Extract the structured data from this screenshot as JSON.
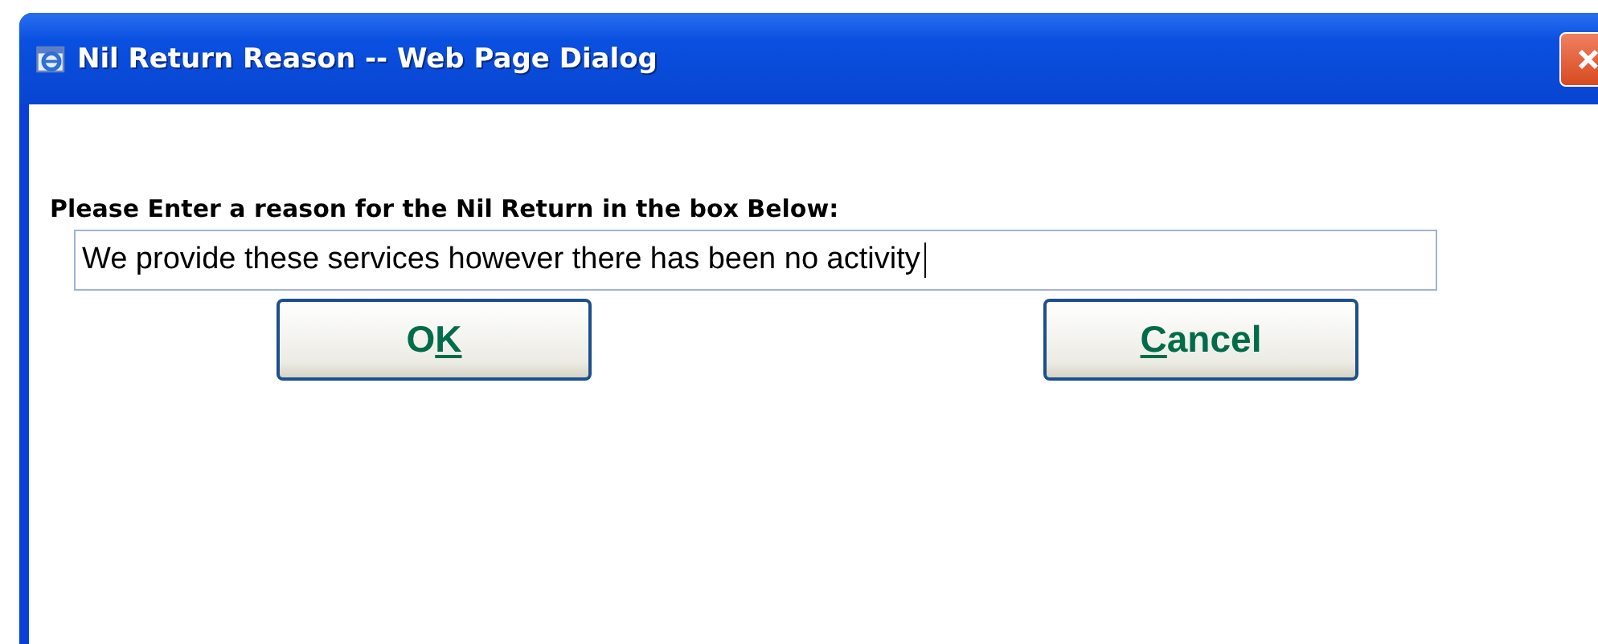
{
  "window": {
    "title": "Nil Return Reason -- Web Page Dialog"
  },
  "prompt": "Please Enter a reason for the Nil Return in the box Below:",
  "reason_field": {
    "value": "We provide these services however there has been no activity",
    "focused": true
  },
  "buttons": [
    {
      "before": "O",
      "key": "K"
    },
    {
      "key": "C",
      "after": "ancel"
    }
  ]
}
